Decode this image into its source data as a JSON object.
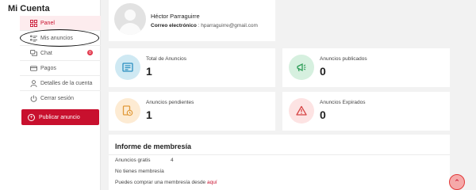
{
  "sidebar": {
    "title": "Mi Cuenta",
    "items": [
      {
        "label": "Panel",
        "icon": "grid-icon"
      },
      {
        "label": "Mis anuncios",
        "icon": "list-icon"
      },
      {
        "label": "Chat",
        "icon": "chat-icon",
        "badge": "0"
      },
      {
        "label": "Pagos",
        "icon": "card-icon"
      },
      {
        "label": "Detalles de la cuenta",
        "icon": "user-icon"
      },
      {
        "label": "Cerrar sesión",
        "icon": "power-icon"
      }
    ],
    "publish_label": "Publicar anuncio",
    "publish_icon": "+"
  },
  "profile": {
    "name": "Héctor Parraguirre",
    "email_label": "Correo electrónico",
    "email_separator": ":",
    "email": "hparraguirre@gmail.com"
  },
  "stats": [
    {
      "label": "Total de Anuncios",
      "value": "1",
      "icon": "tag-icon",
      "bg": "#cfe9f3",
      "color": "#2a8fc0"
    },
    {
      "label": "Anuncios publicados",
      "value": "0",
      "icon": "megaphone-icon",
      "bg": "#d6f0df",
      "color": "#2e9d58"
    },
    {
      "label": "Anuncios pendientes",
      "value": "1",
      "icon": "clock-doc-icon",
      "bg": "#fdebd3",
      "color": "#e19a3a"
    },
    {
      "label": "Anuncios Expirados",
      "value": "0",
      "icon": "warning-icon",
      "bg": "#fde3e3",
      "color": "#d64545"
    }
  ],
  "membership": {
    "title": "Informe de membresía",
    "free_label": "Anuncios gratis",
    "free_count": "4",
    "none_text": "No tienes membresía",
    "buy_text": "Puedes comprar una membresía desde",
    "buy_link": "aquí"
  },
  "colors": {
    "accent": "#c8102e"
  }
}
